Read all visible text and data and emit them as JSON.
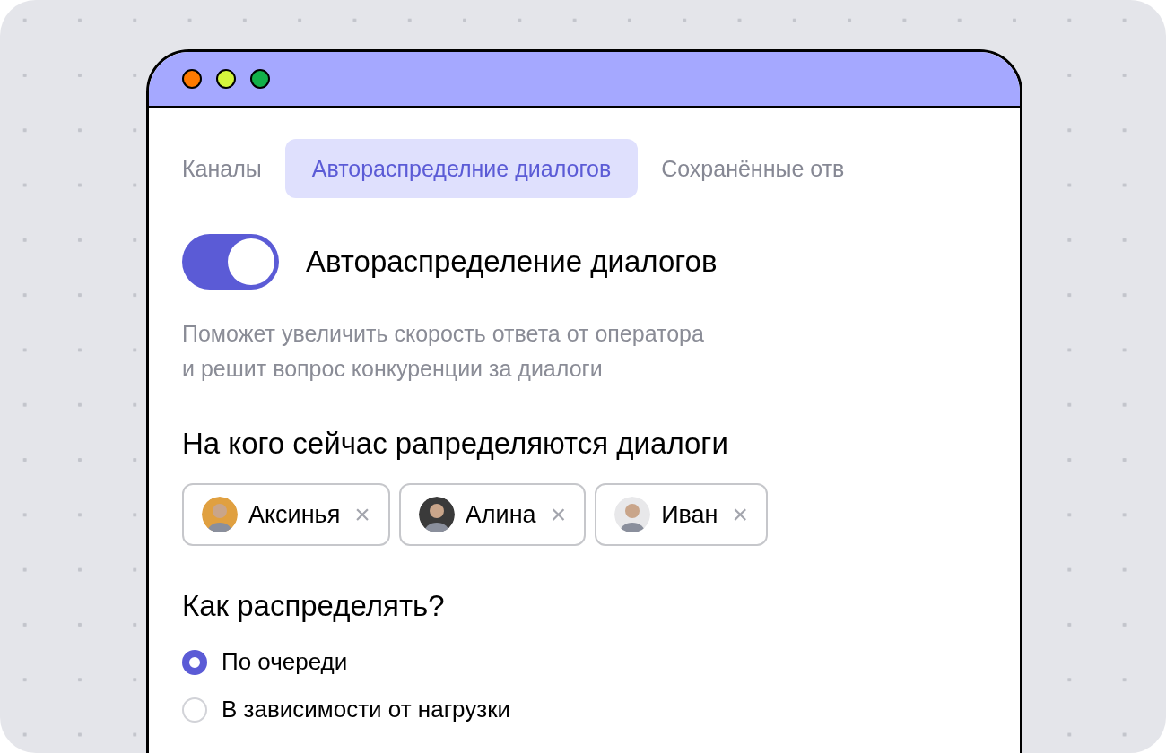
{
  "window": {
    "controls": [
      {
        "color": "#ff7a00"
      },
      {
        "color": "#d4f53c"
      },
      {
        "color": "#12b04a"
      }
    ]
  },
  "tabs": [
    {
      "label": "Каналы",
      "selected": false
    },
    {
      "label": "Автораспределние диалогов",
      "selected": true
    },
    {
      "label": "Сохранённые отв",
      "selected": false
    }
  ],
  "autodistribution": {
    "on": true,
    "label": "Автораспределение диалогов",
    "description": "Поможет увеличить скорость ответа от оператора\nи решит вопрос конкуренции за диалоги"
  },
  "assignees": {
    "title": "На кого сейчас рапределяются диалоги",
    "people": [
      {
        "name": "Аксинья",
        "color": "#e0a040",
        "remove": "×"
      },
      {
        "name": "Алина",
        "color": "#3a3a3a",
        "remove": "×"
      },
      {
        "name": "Иван",
        "color": "#e8e8ea",
        "remove": "×"
      }
    ]
  },
  "method": {
    "title": "Как распределять?",
    "options": [
      {
        "label": "По очереди",
        "selected": true
      },
      {
        "label": "В зависимости от нагрузки",
        "selected": false
      }
    ]
  }
}
